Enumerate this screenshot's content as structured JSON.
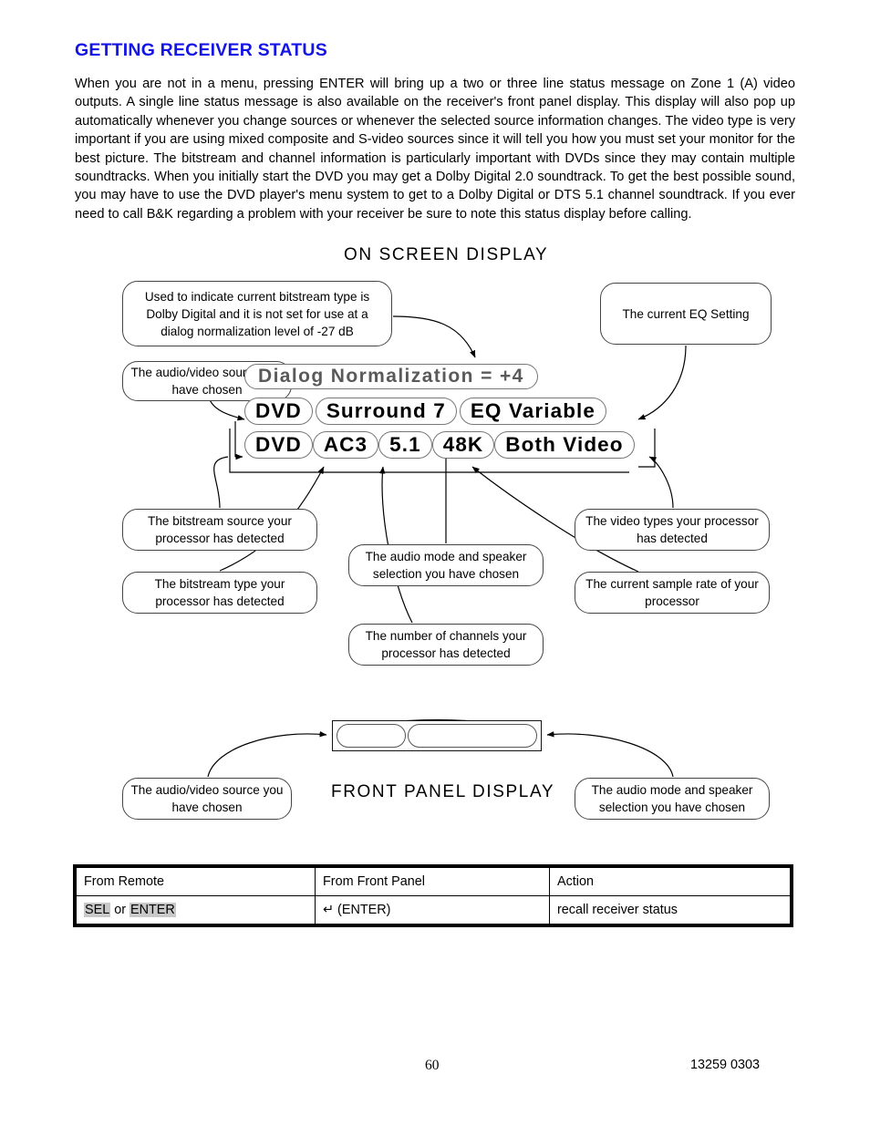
{
  "heading": "GETTING RECEIVER STATUS",
  "body_paragraph": "When you are not in a menu, pressing ENTER will bring up a two or three line status message on Zone 1 (A) video outputs. A single line status message is also available on the receiver's front panel display. This display will also pop up automatically whenever you change sources or whenever the selected source information changes. The video type is very important if you are using mixed composite and S-video sources since it will tell you how you must set your monitor for the best picture. The bitstream and channel information is particularly important with DVDs since they may contain multiple soundtracks. When you initially start the DVD you may get a Dolby Digital 2.0 soundtrack. To get the best possible sound, you may have to use the DVD player's menu system to get to a Dolby Digital or DTS 5.1 channel soundtrack. If you ever need to call B&K regarding a problem with your receiver be sure to note this status display before calling.",
  "osd": {
    "title": "ON SCREEN DISPLAY",
    "dialog_line": "Dialog Normalization = +4",
    "row_primary": [
      "DVD",
      "Surround 7",
      "EQ Variable"
    ],
    "row_secondary": [
      "DVD",
      "AC3",
      "5.1",
      "48K",
      "Both Video"
    ],
    "callouts": {
      "bitstream_dialnorm": "Used to indicate current bitstream type is Dolby Digital and it is not set for use at a dialog normalization level of -27 dB",
      "eq_setting": "The current EQ Setting",
      "av_source": "The audio/video source you have chosen",
      "bitstream_source": "The bitstream source your processor has detected",
      "bitstream_type": "The bitstream type your processor has detected",
      "audio_mode": "The audio mode and speaker selection you have chosen",
      "channel_count": "The number of channels your processor has detected",
      "video_types": "The video types your processor has detected",
      "sample_rate": "The current sample rate of your processor"
    }
  },
  "front_panel": {
    "title": "FRONT PANEL DISPLAY",
    "cell_source": "",
    "cell_mode": "",
    "callouts": {
      "av_source": "The audio/video source you have chosen",
      "audio_mode": "The audio mode and speaker selection you have chosen"
    }
  },
  "key_table": {
    "headers": [
      "From Remote",
      "From Front Panel",
      "Action"
    ],
    "rows": [
      {
        "remote_key_1": "SEL",
        "remote_conjunction": " or ",
        "remote_key_2": "ENTER",
        "front_panel": "↵ (ENTER)",
        "action": "recall receiver status"
      }
    ]
  },
  "footer": {
    "page_number": "60",
    "document_code": "13259 0303"
  },
  "colors": {
    "heading": "#1414e6",
    "osd_dim_text": "#5a5a5a",
    "key_highlight": "#c9c9c9"
  }
}
